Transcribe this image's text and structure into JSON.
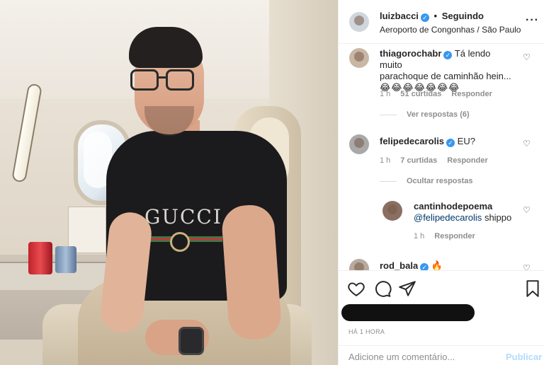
{
  "post": {
    "author": "luizbacci",
    "follow_status": "Seguindo",
    "separator": "•",
    "location": "Aeroporto de Congonhas / São Paulo - CGH /...",
    "more_icon": "more-options-icon",
    "shirt_text": "GUCCI"
  },
  "comments": [
    {
      "user": "thiagorochabr",
      "verified": true,
      "text_line1": "Tá lendo muito",
      "text_line2": "parachoque de caminhão hein...",
      "emojis": "😂😂😂😂😂😂😂",
      "time": "1 h",
      "likes": "51 curtidas",
      "reply": "Responder",
      "replies_toggle": "Ver respostas (6)"
    },
    {
      "user": "felipedecarolis",
      "verified": true,
      "text": "EU?",
      "time": "1 h",
      "likes": "7 curtidas",
      "reply": "Responder",
      "replies_toggle": "Ocultar respostas"
    },
    {
      "user": "cantinhodepoema",
      "verified": false,
      "mention": "@felipedecarolis",
      "text": "shippo",
      "time": "1 h",
      "reply": "Responder"
    },
    {
      "user": "rod_bala",
      "verified": true,
      "text": "🔥"
    }
  ],
  "footer": {
    "time_ago": "HÁ 1 HORA",
    "comment_placeholder": "Adicione um comentário...",
    "publish_label": "Publicar"
  },
  "icons": {
    "like": "heart-icon",
    "comment": "comment-icon",
    "share": "send-icon",
    "save": "bookmark-icon",
    "verified": "verified-badge-icon"
  },
  "colors": {
    "verified_blue": "#3897f0",
    "text": "#262626",
    "muted": "#8e8e8e",
    "publish_disabled": "#b3dbff"
  }
}
